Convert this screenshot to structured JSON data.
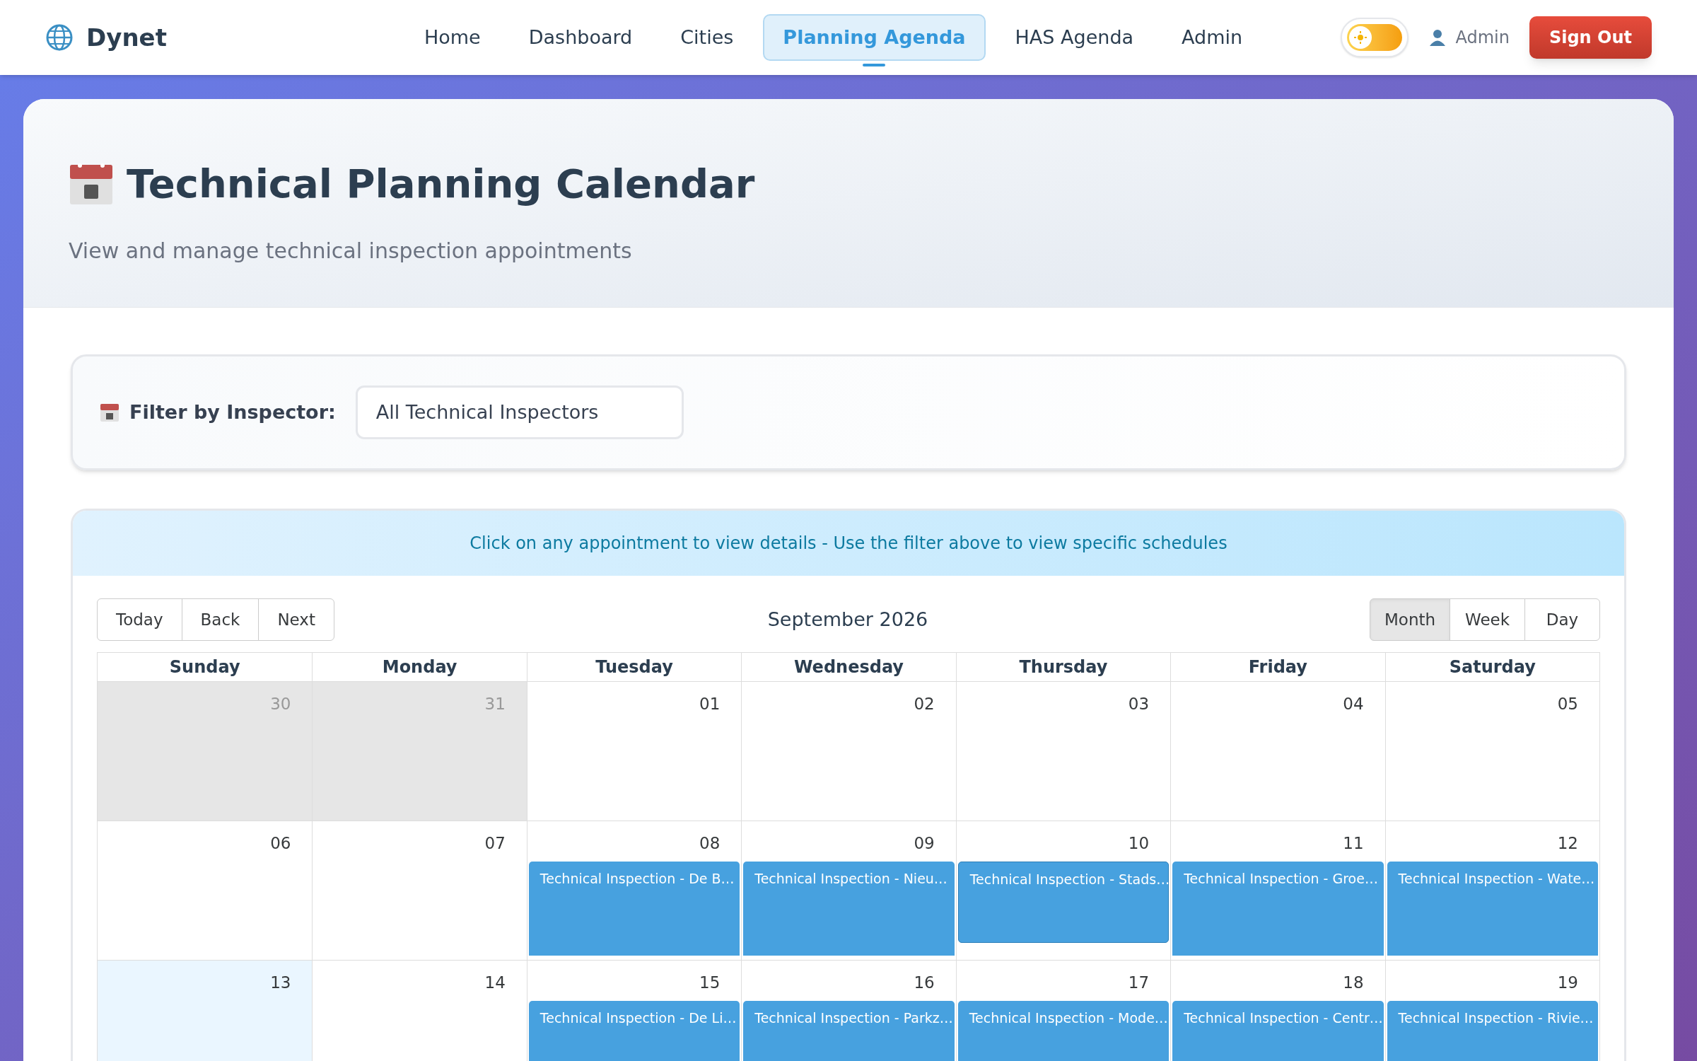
{
  "navbar": {
    "brand": "Dynet",
    "links": [
      {
        "label": "Home",
        "selected": false
      },
      {
        "label": "Dashboard",
        "selected": false
      },
      {
        "label": "Cities",
        "selected": false
      },
      {
        "label": "Planning Agenda",
        "selected": true
      },
      {
        "label": "HAS Agenda",
        "selected": false
      },
      {
        "label": "Admin",
        "selected": false
      }
    ],
    "theme_toggle": {
      "on": false
    },
    "user": "Admin",
    "sign_out": "Sign Out"
  },
  "header": {
    "title": "Technical Planning Calendar",
    "subtitle": "View and manage technical inspection appointments"
  },
  "filter": {
    "label": "Filter by Inspector:",
    "value": "All Technical Inspectors"
  },
  "calendar": {
    "info": "Click on any appointment to view details - Use the filter above to view specific schedules",
    "nav_buttons": [
      "Today",
      "Back",
      "Next"
    ],
    "period": "September 2026",
    "views": [
      {
        "label": "Month",
        "selected": true
      },
      {
        "label": "Week",
        "selected": false
      },
      {
        "label": "Day",
        "selected": false
      }
    ],
    "weekdays": [
      "Sunday",
      "Monday",
      "Tuesday",
      "Wednesday",
      "Thursday",
      "Friday",
      "Saturday"
    ],
    "weeks": [
      {
        "days": [
          {
            "date": "30",
            "off_range": true,
            "today": false
          },
          {
            "date": "31",
            "off_range": true,
            "today": false
          },
          {
            "date": "01",
            "off_range": false,
            "today": false
          },
          {
            "date": "02",
            "off_range": false,
            "today": false
          },
          {
            "date": "03",
            "off_range": false,
            "today": false
          },
          {
            "date": "04",
            "off_range": false,
            "today": false
          },
          {
            "date": "05",
            "off_range": false,
            "today": false
          }
        ]
      },
      {
        "days": [
          {
            "date": "06",
            "off_range": false,
            "today": false
          },
          {
            "date": "07",
            "off_range": false,
            "today": false
          },
          {
            "date": "08",
            "off_range": false,
            "today": false,
            "events": [
              {
                "title": "Technical Inspection - De B…",
                "continues": true
              }
            ]
          },
          {
            "date": "09",
            "off_range": false,
            "today": false,
            "events": [
              {
                "title": "Technical Inspection - Nieu…",
                "continues": true
              }
            ]
          },
          {
            "date": "10",
            "off_range": false,
            "today": false,
            "events": [
              {
                "title": "Technical Inspection - Stads…",
                "continues": false
              }
            ]
          },
          {
            "date": "11",
            "off_range": false,
            "today": false,
            "events": [
              {
                "title": "Technical Inspection - Groe…",
                "continues": true
              }
            ]
          },
          {
            "date": "12",
            "off_range": false,
            "today": false,
            "events": [
              {
                "title": "Technical Inspection - Wate…",
                "continues": true
              }
            ]
          }
        ]
      },
      {
        "days": [
          {
            "date": "13",
            "off_range": false,
            "today": true
          },
          {
            "date": "14",
            "off_range": false,
            "today": false
          },
          {
            "date": "15",
            "off_range": false,
            "today": false,
            "events": [
              {
                "title": "Technical Inspection - De Li…",
                "continues": true
              }
            ]
          },
          {
            "date": "16",
            "off_range": false,
            "today": false,
            "events": [
              {
                "title": "Technical Inspection - Parkz…",
                "continues": true
              }
            ]
          },
          {
            "date": "17",
            "off_range": false,
            "today": false,
            "events": [
              {
                "title": "Technical Inspection - Mode…",
                "continues": true
              }
            ]
          },
          {
            "date": "18",
            "off_range": false,
            "today": false,
            "events": [
              {
                "title": "Technical Inspection - Centr…",
                "continues": true
              }
            ]
          },
          {
            "date": "19",
            "off_range": false,
            "today": false,
            "events": [
              {
                "title": "Technical Inspection - Rivie…",
                "continues": true
              }
            ]
          }
        ]
      }
    ]
  }
}
